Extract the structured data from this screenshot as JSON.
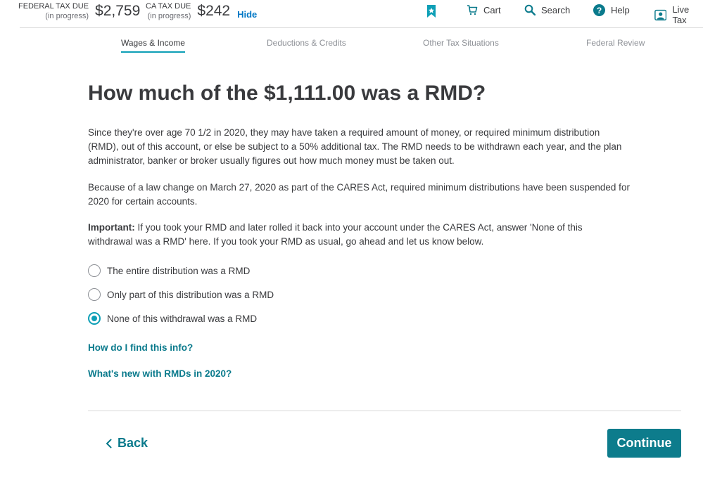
{
  "header": {
    "federal": {
      "label": "FEDERAL TAX DUE",
      "status": "(in progress)",
      "amount": "$2,759"
    },
    "state": {
      "label": "CA TAX DUE",
      "status": "(in progress)",
      "amount": "$242"
    },
    "hide_label": "Hide",
    "nav": {
      "cart": "Cart",
      "search": "Search",
      "help": "Help",
      "live_tax": "Live Tax"
    }
  },
  "tabs": [
    {
      "label": "Wages & Income",
      "active": true
    },
    {
      "label": "Deductions & Credits",
      "active": false
    },
    {
      "label": "Other Tax Situations",
      "active": false
    },
    {
      "label": "Federal Review",
      "active": false
    }
  ],
  "main": {
    "title": "How much of the $1,111.00 was a RMD?",
    "paragraph1": "Since they're over age 70 1/2 in 2020, they may have taken a required amount of money, or required minimum distribution (RMD), out of this account, or else be subject to a 50% additional tax. The RMD needs to be withdrawn each year, and the plan administrator, banker or broker usually figures out how much money must be taken out.",
    "paragraph2": "Because of a law change on March 27, 2020 as part of the CARES Act, required minimum distributions have been suspended for 2020 for certain accounts.",
    "important_label": "Important:",
    "important_text": " If you took your RMD and later rolled it back into your account under the CARES Act, answer 'None of this withdrawal was a RMD' here. If you took your RMD as usual, go ahead and let us know below.",
    "options": [
      {
        "label": "The entire distribution was a RMD",
        "selected": false
      },
      {
        "label": "Only part of this distribution was a RMD",
        "selected": false
      },
      {
        "label": "None of this withdrawal was a RMD",
        "selected": true
      }
    ],
    "links": {
      "find_info": "How do I find this info?",
      "whats_new": "What's new with RMDs in 2020?"
    }
  },
  "footer": {
    "back_label": "Back",
    "continue_label": "Continue"
  },
  "colors": {
    "accent": "#0d9fb6",
    "button": "#0d7c8c",
    "link": "#0a7a8c",
    "hide_link": "#0077c5"
  }
}
